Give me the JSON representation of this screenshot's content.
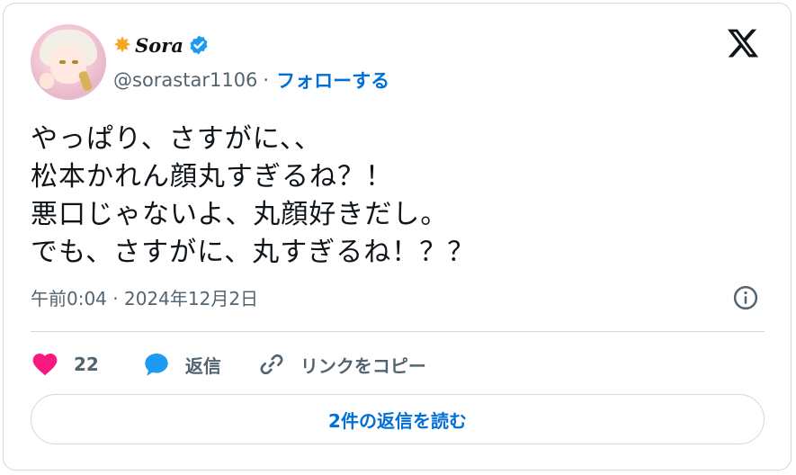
{
  "author": {
    "display_name": "Sora",
    "name_prefix_icon": "star-icon",
    "verified_icon": "verified-badge-icon",
    "handle": "@sorastar1106",
    "separator": "·",
    "follow_label": "フォローする"
  },
  "platform_logo": "x-logo-icon",
  "tweet": {
    "lines": [
      "やっぱり、さすがに、、",
      "松本かれん顔丸すぎるね？！",
      "悪口じゃないよ、丸顔好きだし。",
      "でも、さすがに、丸すぎるね！？？"
    ],
    "timestamp": "午前0:04 · 2024年12月2日"
  },
  "actions": {
    "like_count": "22",
    "reply_label": "返信",
    "copy_link_label": "リンクをコピー"
  },
  "read_replies_label": "2件の返信を読む",
  "colors": {
    "link_blue": "#006fd6",
    "like_pink": "#f91880",
    "reply_blue": "#1d9bf0",
    "verified_blue": "#1d9bf0",
    "muted_text": "#536471",
    "border": "#cfd9de"
  }
}
